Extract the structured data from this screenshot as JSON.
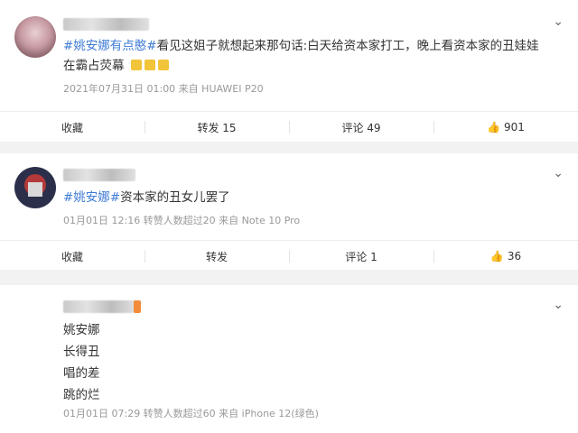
{
  "posts": [
    {
      "topic": "#姚安娜有点憨#",
      "text": "看见这姐子就想起来那句话:白天给资本家打工，晚上看资本家的丑娃娃在霸占荧幕",
      "meta": "2021年07月31日 01:00  来自 HUAWEI P20",
      "actions": {
        "favorite": "收藏",
        "repost": "转发 15",
        "comment": "评论 49",
        "like": "901"
      }
    },
    {
      "topic": "#姚安娜#",
      "text": "资本家的丑女儿罢了",
      "meta": "01月01日 12:16  转赞人数超过20  来自 Note 10 Pro",
      "actions": {
        "favorite": "收藏",
        "repost": "转发",
        "comment": "评论 1",
        "like": "36"
      }
    },
    {
      "lines": [
        "姚安娜",
        "长得丑",
        "唱的差",
        "跳的烂"
      ],
      "meta": "01月01日 07:29  转赞人数超过60  来自 iPhone 12(绿色)"
    }
  ],
  "icons": {
    "dropdown": "chevron-down-icon",
    "like": "thumbs-up-icon"
  },
  "colors": {
    "topic": "#3e7bd6",
    "background": "#f2f2f2"
  }
}
